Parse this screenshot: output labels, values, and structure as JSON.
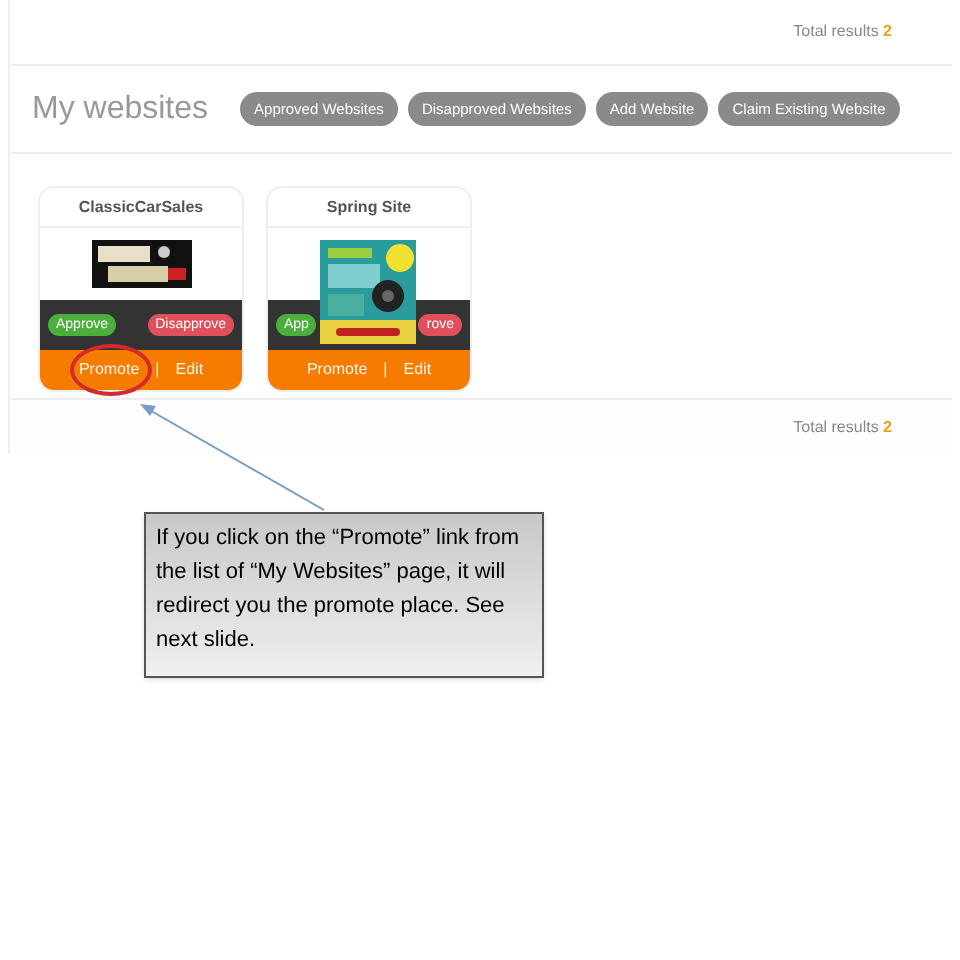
{
  "top_total": {
    "label": "Total results",
    "count": "2"
  },
  "header": {
    "title": "My websites",
    "buttons": [
      "Approved Websites",
      "Disapproved Websites",
      "Add Website",
      "Claim Existing Website"
    ]
  },
  "websites": [
    {
      "name": "ClassicCarSales",
      "thumbnail": {
        "kind": "logo"
      },
      "approve": "Approve",
      "disapprove": "Disapprove",
      "promote": "Promote",
      "separator": "|",
      "edit": "Edit",
      "highlighted": true
    },
    {
      "name": "Spring Site",
      "thumbnail": {
        "kind": "banner"
      },
      "approve": "App",
      "disapprove": "rove",
      "promote": "Promote",
      "separator": "|",
      "edit": "Edit",
      "highlighted": false
    }
  ],
  "bottom_total": {
    "label": "Total results",
    "count": "2"
  },
  "callout": {
    "text": "If you click on the “Promote” link from the list of “My Websites” page, it will redirect you the promote place. See next slide."
  }
}
